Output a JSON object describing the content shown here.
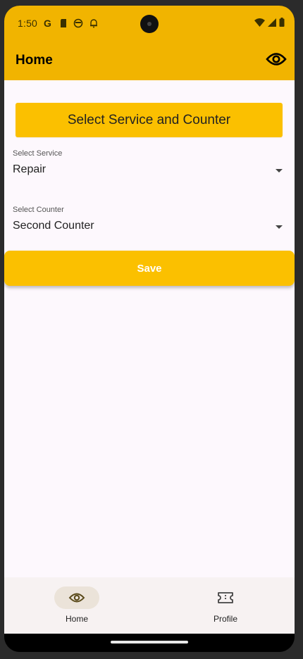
{
  "status_bar": {
    "time": "1:50",
    "left_icons": [
      "google-icon",
      "sim-card-icon",
      "face-icon",
      "notification-bell-icon"
    ],
    "right_icons": [
      "wifi-icon",
      "signal-icon",
      "battery-icon"
    ]
  },
  "app_bar": {
    "title": "Home",
    "action_icon": "eye-icon"
  },
  "main": {
    "header_button_label": "Select Service and Counter",
    "service_field": {
      "label": "Select Service",
      "value": "Repair"
    },
    "counter_field": {
      "label": "Select Counter",
      "value": "Second Counter"
    },
    "save_label": "Save"
  },
  "bottom_nav": {
    "items": [
      {
        "label": "Home",
        "icon": "eye-icon",
        "selected": true
      },
      {
        "label": "Profile",
        "icon": "ticket-icon",
        "selected": false
      }
    ]
  },
  "colors": {
    "accent": "#fbc000",
    "app_bar": "#f1b400",
    "background": "#fdf8fd"
  }
}
